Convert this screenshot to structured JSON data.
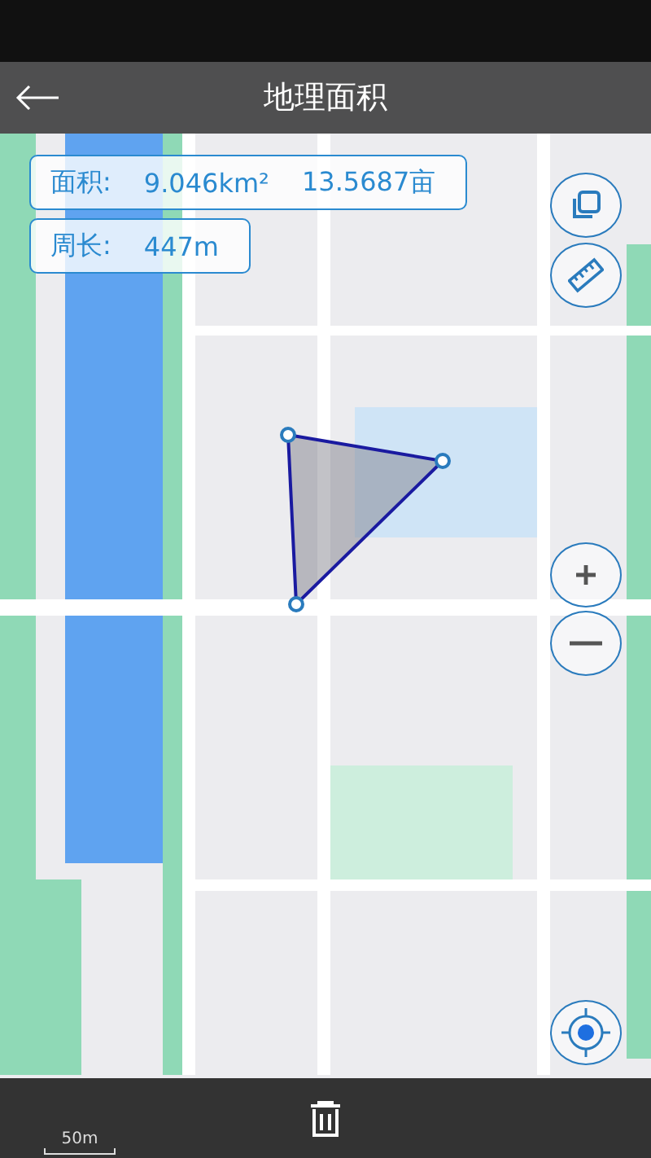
{
  "header": {
    "title": "地理面积"
  },
  "measurements": [
    {
      "label": "面积:",
      "values": [
        "9.046km²",
        "13.5687亩"
      ]
    },
    {
      "label": "周长:",
      "values": [
        "447m"
      ]
    }
  ],
  "scale": {
    "label": "50m"
  }
}
